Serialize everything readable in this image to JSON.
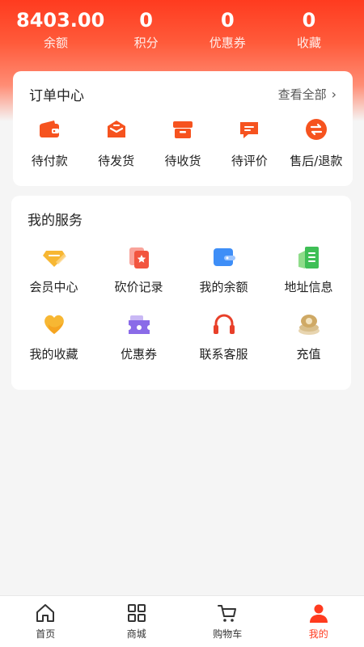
{
  "header": {
    "stats": [
      {
        "value": "8403.00",
        "label": "余额"
      },
      {
        "value": "0",
        "label": "积分"
      },
      {
        "value": "0",
        "label": "优惠券"
      },
      {
        "value": "0",
        "label": "收藏"
      }
    ]
  },
  "orders": {
    "title": "订单中心",
    "view_all": "查看全部",
    "items": [
      {
        "label": "待付款",
        "icon": "wallet-icon"
      },
      {
        "label": "待发货",
        "icon": "package-icon"
      },
      {
        "label": "待收货",
        "icon": "box-icon"
      },
      {
        "label": "待评价",
        "icon": "comment-icon"
      },
      {
        "label": "售后/退款",
        "icon": "exchange-icon"
      }
    ]
  },
  "services": {
    "title": "我的服务",
    "items": [
      {
        "label": "会员中心",
        "icon": "diamond-icon"
      },
      {
        "label": "砍价记录",
        "icon": "bargain-icon"
      },
      {
        "label": "我的余额",
        "icon": "balance-card-icon"
      },
      {
        "label": "地址信息",
        "icon": "address-list-icon"
      },
      {
        "label": "我的收藏",
        "icon": "heart-icon"
      },
      {
        "label": "优惠券",
        "icon": "coupon-icon"
      },
      {
        "label": "联系客服",
        "icon": "headset-icon"
      },
      {
        "label": "充值",
        "icon": "coin-stack-icon"
      }
    ]
  },
  "tabbar": {
    "items": [
      {
        "label": "首页",
        "icon": "home-icon"
      },
      {
        "label": "商城",
        "icon": "grid-icon"
      },
      {
        "label": "购物车",
        "icon": "cart-icon"
      },
      {
        "label": "我的",
        "icon": "user-icon"
      }
    ],
    "active_index": 3
  },
  "colors": {
    "accent": "#ff3b1f",
    "order_icon": "#f6531f"
  }
}
